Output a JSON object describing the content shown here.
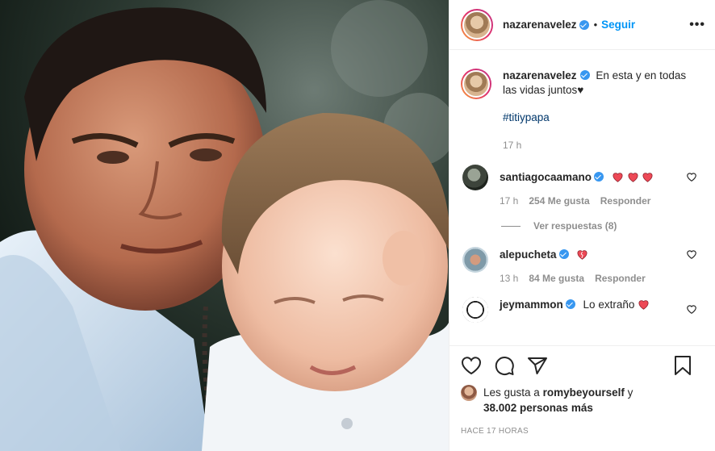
{
  "post": {
    "author": "nazarenavelez",
    "follow_label": "Seguir",
    "dot": "•",
    "more_label": "•••"
  },
  "caption": {
    "author": "nazarenavelez",
    "text": "En esta y en todas las vidas juntos♥",
    "hashtag": "#titiypapa",
    "time": "17 h"
  },
  "comments": [
    {
      "user": "santiagocaamano",
      "verified": true,
      "text": "",
      "time": "17 h",
      "likes": "254 Me gusta",
      "reply": "Responder"
    },
    {
      "user": "alepucheta",
      "verified": true,
      "text": "",
      "time": "13 h",
      "likes": "84 Me gusta",
      "reply": "Responder"
    },
    {
      "user": "jeymammon",
      "verified": true,
      "text": "Lo extraño",
      "time": "",
      "likes": "",
      "reply": ""
    }
  ],
  "view_replies": "Ver respuestas (8)",
  "likes": {
    "prefix": "Les gusta a",
    "user": "romybeyourself",
    "conj": "y",
    "rest": "38.002 personas más"
  },
  "posted_ago": "HACE 17 HORAS",
  "colors": {
    "accent": "#0095f6",
    "verified": "#3897f0",
    "heart": "#ed4956"
  },
  "icons": [
    "verified-icon",
    "heart-icon",
    "comment-icon",
    "share-icon",
    "save-icon",
    "more-icon"
  ]
}
